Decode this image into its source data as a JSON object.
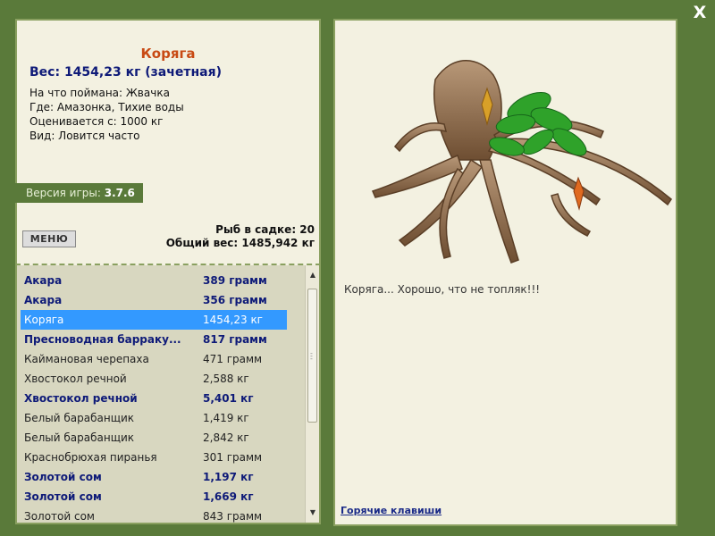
{
  "close_label": "X",
  "detail": {
    "title": "Коряга",
    "weight": "Вес: 1454,23 кг (зачетная)",
    "caught_on": "На что поймана: Жвачка",
    "where": "Где: Амазонка, Тихие воды",
    "rated_from": "Оценивается с: 1000 кг",
    "kind": "Вид: Ловится часто"
  },
  "version": {
    "label": "Версия игры:",
    "value": "3.7.6"
  },
  "menu_label": "МЕНЮ",
  "stats": {
    "fish_in_keepnet": "Рыб в садке: 20",
    "total_weight": "Общий вес: 1485,942 кг"
  },
  "catch_list": [
    {
      "name": "Акара",
      "weight": "389 грамм",
      "style": "bold"
    },
    {
      "name": "Акара",
      "weight": "356 грамм",
      "style": "bold"
    },
    {
      "name": "Коряга",
      "weight": "1454,23 кг",
      "style": "selected"
    },
    {
      "name": "Пресноводная барраку...",
      "weight": "817 грамм",
      "style": "bold"
    },
    {
      "name": "Каймановая черепаха",
      "weight": "471 грамм",
      "style": "normal"
    },
    {
      "name": "Хвостокол речной",
      "weight": "2,588 кг",
      "style": "normal"
    },
    {
      "name": "Хвостокол речной",
      "weight": "5,401 кг",
      "style": "bold"
    },
    {
      "name": "Белый барабанщик",
      "weight": "1,419 кг",
      "style": "normal"
    },
    {
      "name": "Белый барабанщик",
      "weight": "2,842 кг",
      "style": "normal"
    },
    {
      "name": "Краснобрюхая пиранья",
      "weight": "301 грамм",
      "style": "normal"
    },
    {
      "name": "Золотой сом",
      "weight": "1,197 кг",
      "style": "bold"
    },
    {
      "name": "Золотой сом",
      "weight": "1,669 кг",
      "style": "bold"
    },
    {
      "name": "Золотой сом",
      "weight": "843 грамм",
      "style": "normal"
    }
  ],
  "comment": "Коряга... Хорошо, что не топляк!!!",
  "hotkeys_link": "Горячие клавиши",
  "colors": {
    "background": "#5a7a3a",
    "panel": "#f3f1e1",
    "title": "#c84a14",
    "bold_text": "#0e1a78",
    "selected_row": "#3399ff"
  }
}
